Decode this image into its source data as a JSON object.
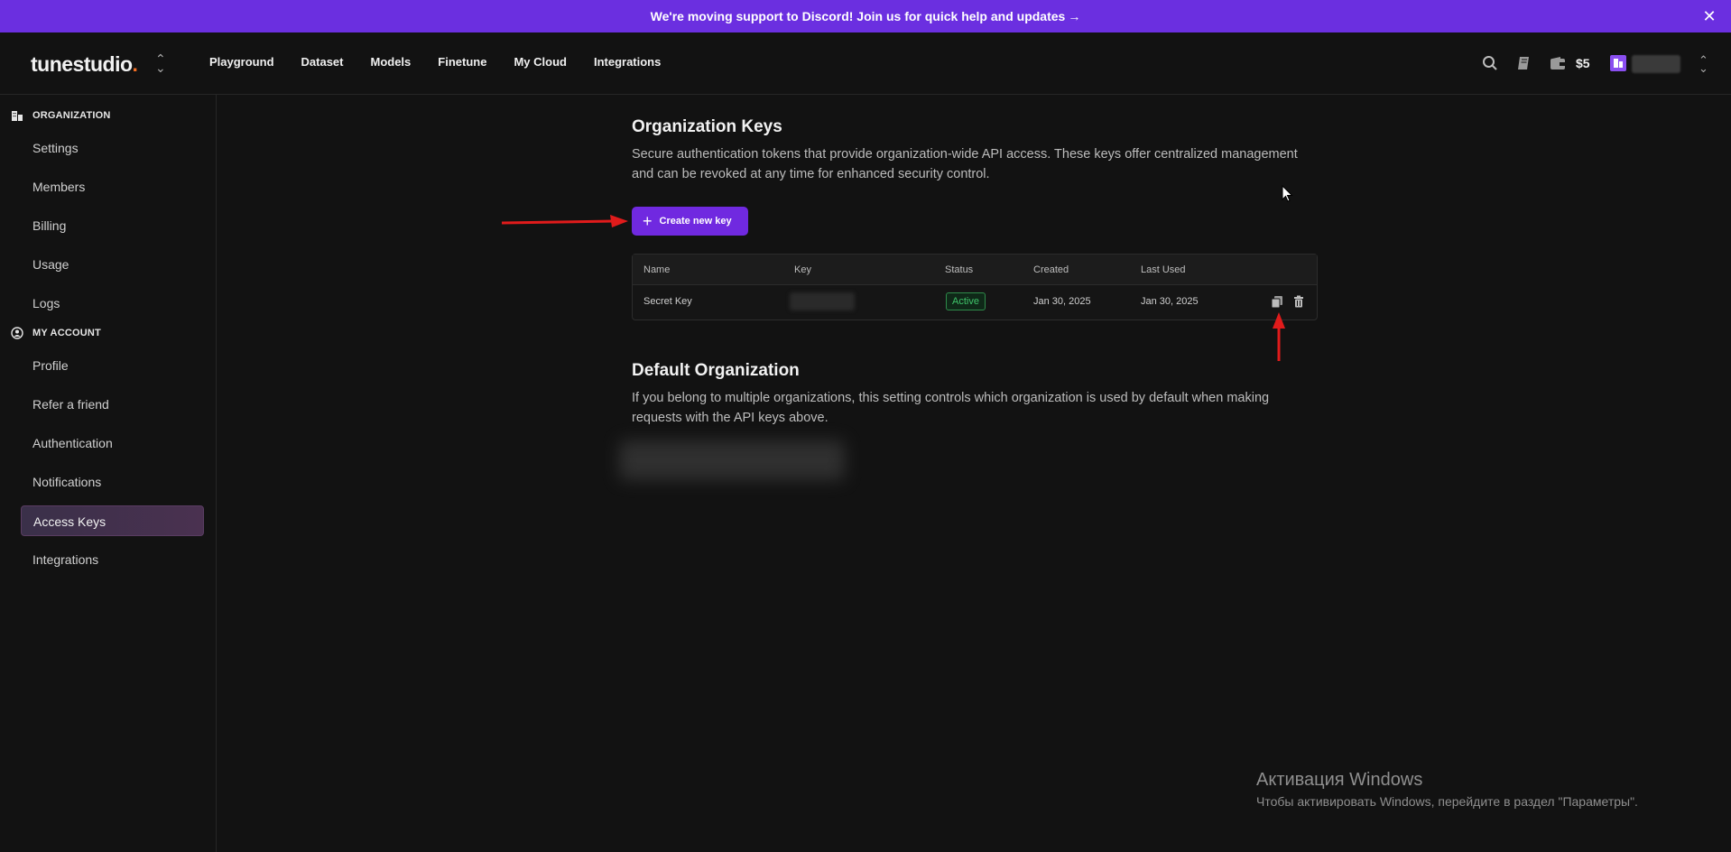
{
  "banner": {
    "text": "We're moving support to Discord! Join us for quick help and updates",
    "arrow": "→",
    "close_icon": "close-icon"
  },
  "brand": {
    "name_main": "tunestudio",
    "name_dot": ".",
    "accent": "#f26d22"
  },
  "nav": {
    "links": [
      "Playground",
      "Dataset",
      "Models",
      "Finetune",
      "My Cloud",
      "Integrations"
    ],
    "price": "$5",
    "icons": [
      "search-icon",
      "book-icon",
      "wallet-icon"
    ]
  },
  "sidebar": {
    "organization_title": "ORGANIZATION",
    "organization_items": [
      "Settings",
      "Members",
      "Billing",
      "Usage",
      "Logs"
    ],
    "account_title": "MY ACCOUNT",
    "account_items": [
      "Profile",
      "Refer a friend",
      "Authentication",
      "Notifications",
      "Access Keys",
      "Integrations"
    ],
    "active_item": "Access Keys"
  },
  "org_keys": {
    "title": "Organization Keys",
    "description": "Secure authentication tokens that provide organization-wide API access. These keys offer centralized management and can be revoked at any time for enhanced security control.",
    "create_button": "Create new key",
    "columns": [
      "Name",
      "Key",
      "Status",
      "Created",
      "Last Used"
    ],
    "rows": [
      {
        "name": "Secret Key",
        "status": "Active",
        "created": "Jan 30, 2025",
        "last_used": "Jan 30, 2025"
      }
    ]
  },
  "default_org": {
    "title": "Default Organization",
    "description": "If you belong to multiple organizations, this setting controls which organization is used by default when making requests with the API keys above."
  },
  "windows_activation": {
    "title": "Активация Windows",
    "subtitle": "Чтобы активировать Windows, перейдите в раздел \"Параметры\"."
  },
  "colors": {
    "accent_purple": "#7029e0",
    "banner": "#6b2fe0",
    "status_green": "#3fc46a",
    "annotation_red": "#e01b1b"
  }
}
